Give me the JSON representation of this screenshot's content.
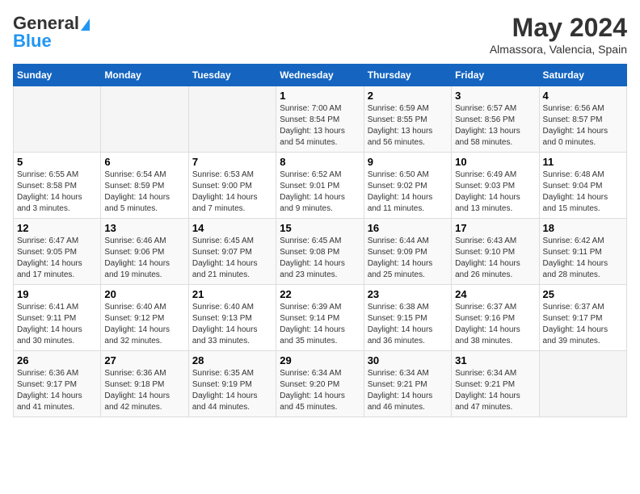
{
  "header": {
    "logo_general": "General",
    "logo_blue": "Blue",
    "month": "May 2024",
    "location": "Almassora, Valencia, Spain"
  },
  "days_of_week": [
    "Sunday",
    "Monday",
    "Tuesday",
    "Wednesday",
    "Thursday",
    "Friday",
    "Saturday"
  ],
  "weeks": [
    {
      "cells": [
        {
          "day": "",
          "info": ""
        },
        {
          "day": "",
          "info": ""
        },
        {
          "day": "",
          "info": ""
        },
        {
          "day": "1",
          "info": "Sunrise: 7:00 AM\nSunset: 8:54 PM\nDaylight: 13 hours\nand 54 minutes."
        },
        {
          "day": "2",
          "info": "Sunrise: 6:59 AM\nSunset: 8:55 PM\nDaylight: 13 hours\nand 56 minutes."
        },
        {
          "day": "3",
          "info": "Sunrise: 6:57 AM\nSunset: 8:56 PM\nDaylight: 13 hours\nand 58 minutes."
        },
        {
          "day": "4",
          "info": "Sunrise: 6:56 AM\nSunset: 8:57 PM\nDaylight: 14 hours\nand 0 minutes."
        }
      ]
    },
    {
      "cells": [
        {
          "day": "5",
          "info": "Sunrise: 6:55 AM\nSunset: 8:58 PM\nDaylight: 14 hours\nand 3 minutes."
        },
        {
          "day": "6",
          "info": "Sunrise: 6:54 AM\nSunset: 8:59 PM\nDaylight: 14 hours\nand 5 minutes."
        },
        {
          "day": "7",
          "info": "Sunrise: 6:53 AM\nSunset: 9:00 PM\nDaylight: 14 hours\nand 7 minutes."
        },
        {
          "day": "8",
          "info": "Sunrise: 6:52 AM\nSunset: 9:01 PM\nDaylight: 14 hours\nand 9 minutes."
        },
        {
          "day": "9",
          "info": "Sunrise: 6:50 AM\nSunset: 9:02 PM\nDaylight: 14 hours\nand 11 minutes."
        },
        {
          "day": "10",
          "info": "Sunrise: 6:49 AM\nSunset: 9:03 PM\nDaylight: 14 hours\nand 13 minutes."
        },
        {
          "day": "11",
          "info": "Sunrise: 6:48 AM\nSunset: 9:04 PM\nDaylight: 14 hours\nand 15 minutes."
        }
      ]
    },
    {
      "cells": [
        {
          "day": "12",
          "info": "Sunrise: 6:47 AM\nSunset: 9:05 PM\nDaylight: 14 hours\nand 17 minutes."
        },
        {
          "day": "13",
          "info": "Sunrise: 6:46 AM\nSunset: 9:06 PM\nDaylight: 14 hours\nand 19 minutes."
        },
        {
          "day": "14",
          "info": "Sunrise: 6:45 AM\nSunset: 9:07 PM\nDaylight: 14 hours\nand 21 minutes."
        },
        {
          "day": "15",
          "info": "Sunrise: 6:45 AM\nSunset: 9:08 PM\nDaylight: 14 hours\nand 23 minutes."
        },
        {
          "day": "16",
          "info": "Sunrise: 6:44 AM\nSunset: 9:09 PM\nDaylight: 14 hours\nand 25 minutes."
        },
        {
          "day": "17",
          "info": "Sunrise: 6:43 AM\nSunset: 9:10 PM\nDaylight: 14 hours\nand 26 minutes."
        },
        {
          "day": "18",
          "info": "Sunrise: 6:42 AM\nSunset: 9:11 PM\nDaylight: 14 hours\nand 28 minutes."
        }
      ]
    },
    {
      "cells": [
        {
          "day": "19",
          "info": "Sunrise: 6:41 AM\nSunset: 9:11 PM\nDaylight: 14 hours\nand 30 minutes."
        },
        {
          "day": "20",
          "info": "Sunrise: 6:40 AM\nSunset: 9:12 PM\nDaylight: 14 hours\nand 32 minutes."
        },
        {
          "day": "21",
          "info": "Sunrise: 6:40 AM\nSunset: 9:13 PM\nDaylight: 14 hours\nand 33 minutes."
        },
        {
          "day": "22",
          "info": "Sunrise: 6:39 AM\nSunset: 9:14 PM\nDaylight: 14 hours\nand 35 minutes."
        },
        {
          "day": "23",
          "info": "Sunrise: 6:38 AM\nSunset: 9:15 PM\nDaylight: 14 hours\nand 36 minutes."
        },
        {
          "day": "24",
          "info": "Sunrise: 6:37 AM\nSunset: 9:16 PM\nDaylight: 14 hours\nand 38 minutes."
        },
        {
          "day": "25",
          "info": "Sunrise: 6:37 AM\nSunset: 9:17 PM\nDaylight: 14 hours\nand 39 minutes."
        }
      ]
    },
    {
      "cells": [
        {
          "day": "26",
          "info": "Sunrise: 6:36 AM\nSunset: 9:17 PM\nDaylight: 14 hours\nand 41 minutes."
        },
        {
          "day": "27",
          "info": "Sunrise: 6:36 AM\nSunset: 9:18 PM\nDaylight: 14 hours\nand 42 minutes."
        },
        {
          "day": "28",
          "info": "Sunrise: 6:35 AM\nSunset: 9:19 PM\nDaylight: 14 hours\nand 44 minutes."
        },
        {
          "day": "29",
          "info": "Sunrise: 6:34 AM\nSunset: 9:20 PM\nDaylight: 14 hours\nand 45 minutes."
        },
        {
          "day": "30",
          "info": "Sunrise: 6:34 AM\nSunset: 9:21 PM\nDaylight: 14 hours\nand 46 minutes."
        },
        {
          "day": "31",
          "info": "Sunrise: 6:34 AM\nSunset: 9:21 PM\nDaylight: 14 hours\nand 47 minutes."
        },
        {
          "day": "",
          "info": ""
        }
      ]
    }
  ]
}
